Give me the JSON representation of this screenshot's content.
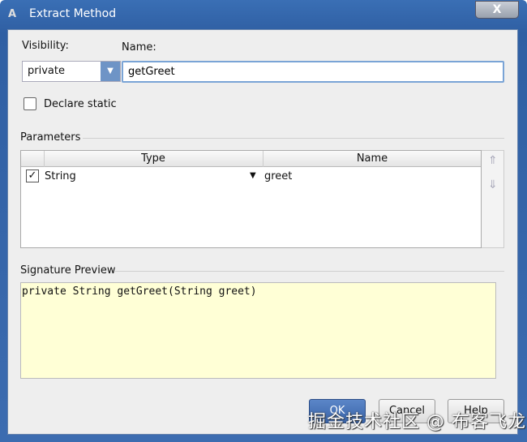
{
  "window": {
    "title": "Extract Method",
    "close": "X"
  },
  "form": {
    "visibility_label": "Visibility:",
    "visibility_value": "private",
    "name_label": "Name:",
    "name_value": "getGreet",
    "declare_static": "Declare static"
  },
  "parameters": {
    "label": "Parameters",
    "columns": [
      "Type",
      "Name"
    ],
    "rows": [
      {
        "checked": true,
        "type": "String",
        "name": "greet"
      }
    ]
  },
  "signature": {
    "label": "Signature Preview",
    "text": "private String getGreet(String greet)"
  },
  "buttons": {
    "ok": "OK",
    "cancel": "Cancel",
    "help": "Help"
  },
  "watermark": "掘金技术社区 @ 布客飞龙"
}
